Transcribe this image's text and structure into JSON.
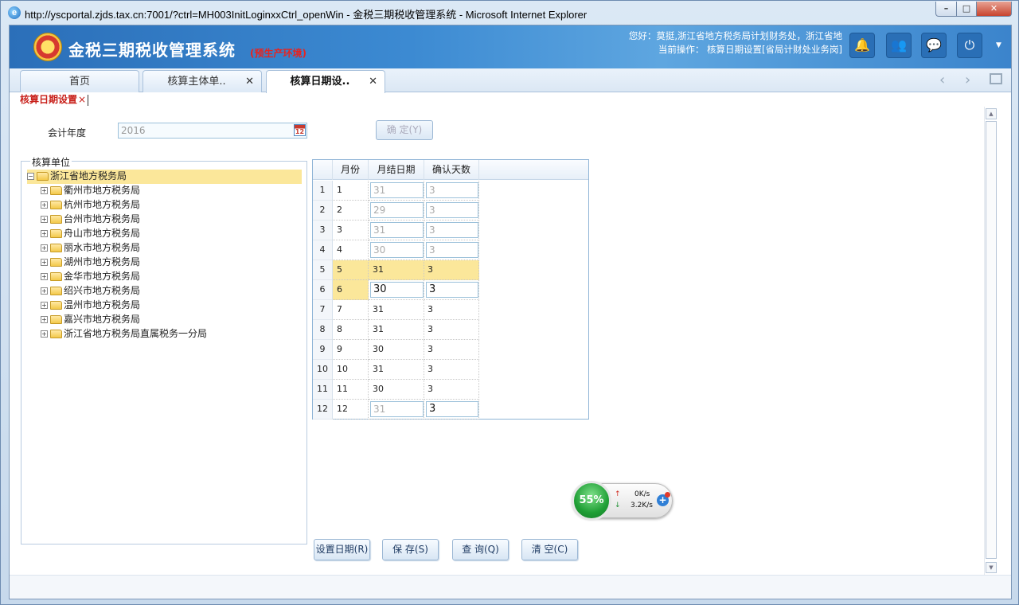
{
  "window": {
    "title": "http://yscportal.zjds.tax.cn:7001/?ctrl=MH003InitLoginxxCtrl_openWin - 金税三期税收管理系统 - Microsoft Internet Explorer",
    "min_glyph": "–",
    "max_glyph": "□",
    "close_glyph": "✕"
  },
  "header": {
    "app_title": "金税三期税收管理系统",
    "env_label": "(预生产环境)",
    "greeting": "您好：莫挺,浙江省地方税务局计划财务处，浙江省地",
    "current_op": "当前操作：  核算日期设置[省局计财处业务岗]",
    "icons": [
      "bell-icon",
      "users-icon",
      "chat-icon",
      "power-icon"
    ],
    "bell_glyph": "🔔",
    "users_glyph": "👥",
    "chat_glyph": "💬",
    "power_glyph": "⏻",
    "menu_glyph": "▼"
  },
  "tabs": [
    {
      "label": "首页",
      "closable": false
    },
    {
      "label": "核算主体单..",
      "closable": true
    },
    {
      "label": "核算日期设..",
      "closable": true,
      "active": true
    }
  ],
  "tab_close_glyph": "✕",
  "nav": {
    "prev": "‹",
    "next": "›"
  },
  "subtab": {
    "label": "核算日期设置",
    "close": "×"
  },
  "form": {
    "year_label": "会计年度",
    "year_value": "2016",
    "calendar_glyph": "12",
    "confirm_label": "确  定(Y)"
  },
  "tree": {
    "section_label": "核算单位",
    "root": {
      "label": "浙江省地方税务局",
      "toggle": "⊟"
    },
    "expand_glyph": "+",
    "children": [
      "衢州市地方税务局",
      "杭州市地方税务局",
      "台州市地方税务局",
      "舟山市地方税务局",
      "丽水市地方税务局",
      "湖州市地方税务局",
      "金华市地方税务局",
      "绍兴市地方税务局",
      "温州市地方税务局",
      "嘉兴市地方税务局",
      "浙江省地方税务局直属税务一分局"
    ]
  },
  "grid": {
    "headers": [
      "月份",
      "月结日期",
      "确认天数"
    ],
    "rows": [
      {
        "row": "1",
        "month": "1",
        "date": "31",
        "days": "3"
      },
      {
        "row": "2",
        "month": "2",
        "date": "29",
        "days": "3"
      },
      {
        "row": "3",
        "month": "3",
        "date": "31",
        "days": "3"
      },
      {
        "row": "4",
        "month": "4",
        "date": "30",
        "days": "3"
      },
      {
        "row": "5",
        "month": "5",
        "date": "31",
        "days": "3"
      },
      {
        "row": "6",
        "month": "6",
        "date": "30",
        "days": "3"
      },
      {
        "row": "7",
        "month": "7",
        "date": "31",
        "days": "3"
      },
      {
        "row": "8",
        "month": "8",
        "date": "31",
        "days": "3"
      },
      {
        "row": "9",
        "month": "9",
        "date": "30",
        "days": "3"
      },
      {
        "row": "10",
        "month": "10",
        "date": "31",
        "days": "3"
      },
      {
        "row": "11",
        "month": "11",
        "date": "30",
        "days": "3"
      },
      {
        "row": "12",
        "month": "12",
        "date": "31",
        "days": "3"
      }
    ]
  },
  "actions": {
    "set_date": "设置日期(R)",
    "save": "保  存(S)",
    "query": "查  询(Q)",
    "clear": "清  空(C)"
  },
  "net_widget": {
    "percent": "55%",
    "up_arrow": "↑",
    "down_arrow": "↓",
    "up_speed": "0K/s",
    "down_speed": "3.2K/s",
    "plus": "+"
  },
  "scrollbar": {
    "up": "▲",
    "down": "▼"
  },
  "colors": {
    "header_blue": "#3c8ad2",
    "highlight_yellow": "#fbe79a",
    "env_red": "#e8231f",
    "subtab_red": "#c8201a"
  }
}
